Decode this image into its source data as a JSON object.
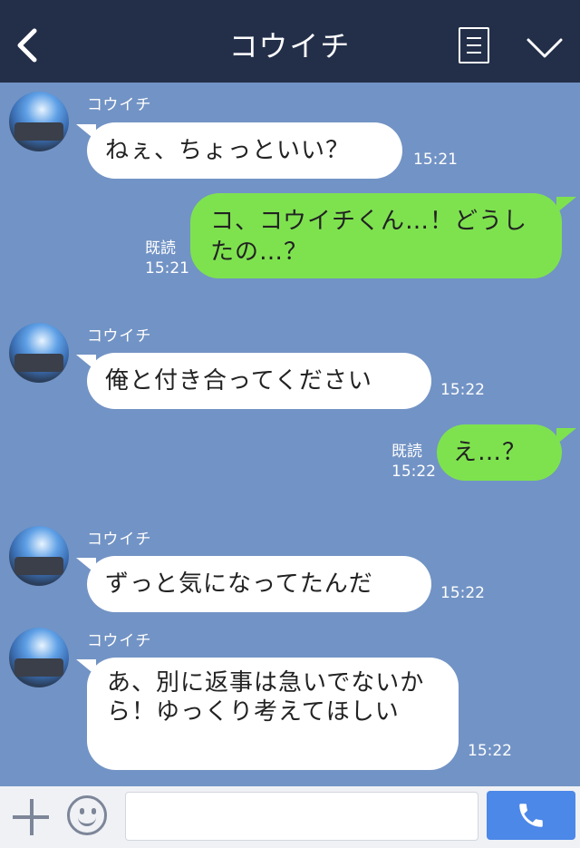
{
  "header": {
    "title": "コウイチ"
  },
  "messages": [
    {
      "type": "in",
      "name": "コウイチ",
      "text": "ねぇ、ちょっといい？",
      "time": "15:21"
    },
    {
      "type": "out",
      "text": "コ、コウイチくん…！どうしたの…？",
      "read": "既読",
      "time": "15:21"
    },
    {
      "type": "in",
      "name": "コウイチ",
      "text": "俺と付き合ってください",
      "time": "15:22"
    },
    {
      "type": "out",
      "text": "え…？",
      "read": "既読",
      "time": "15:22"
    },
    {
      "type": "in",
      "name": "コウイチ",
      "text": "ずっと気になってたんだ",
      "time": "15:22"
    },
    {
      "type": "in",
      "name": "コウイチ",
      "text": "あ、別に返事は急いでないから！ゆっくり考えてほしい",
      "time": "15:22"
    }
  ],
  "footer": {
    "input_placeholder": ""
  },
  "colors": {
    "header_bg": "#232f49",
    "chat_bg": "#7293c5",
    "outgoing_bubble": "#7ee24f",
    "incoming_bubble": "#ffffff",
    "send_button": "#4c88e8"
  },
  "icons": {
    "back": "back-arrow-icon",
    "menu": "list-icon",
    "collapse": "chevron-down-icon",
    "attach": "plus-icon",
    "emoji": "smiley-icon",
    "send": "phone-icon"
  }
}
